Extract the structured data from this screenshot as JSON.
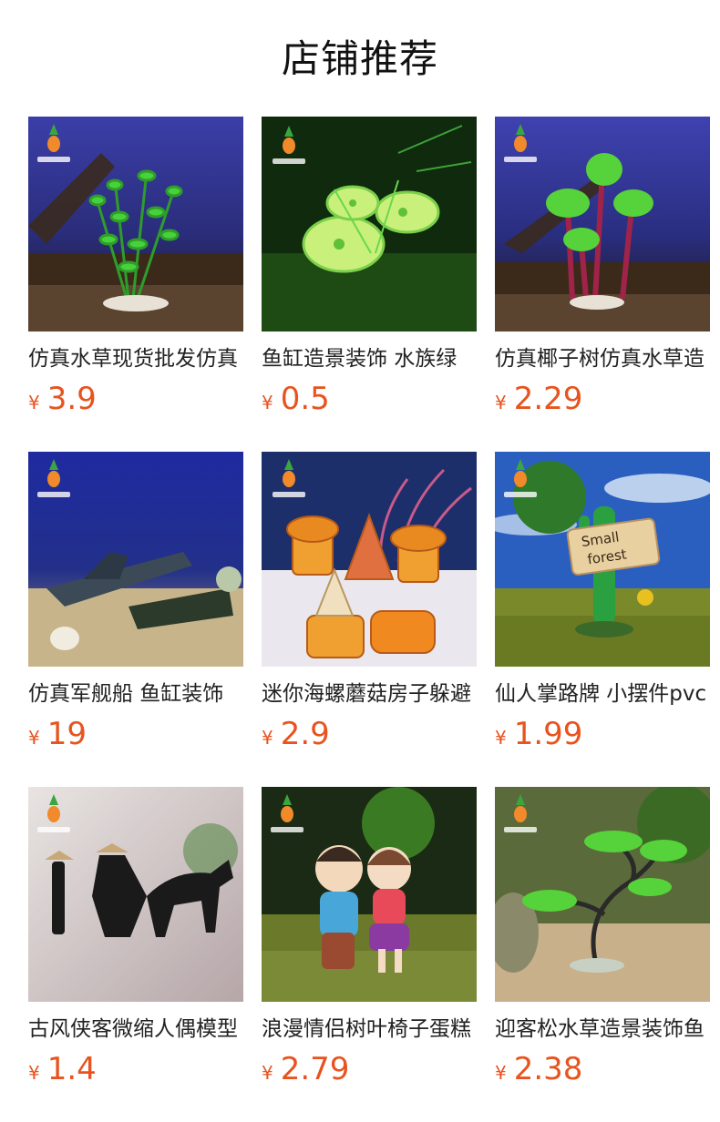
{
  "section_title": "店铺推荐",
  "currency": "¥",
  "accent_color": "#e8531f",
  "products": [
    {
      "name": "仿真水草现货批发仿真",
      "price": "3.9",
      "image": "aquarium-plant-green"
    },
    {
      "name": "鱼缸造景装饰 水族绿",
      "price": "0.5",
      "image": "lotus-leaf-plant"
    },
    {
      "name": "仿真椰子树仿真水草造",
      "price": "2.29",
      "image": "coconut-tree-plant"
    },
    {
      "name": "仿真军舰船 鱼缸装饰",
      "price": "19",
      "image": "warship-wreck"
    },
    {
      "name": "迷你海螺蘑菇房子躲避",
      "price": "2.9",
      "image": "mushroom-houses"
    },
    {
      "name": "仙人掌路牌 小摆件pvc",
      "price": "1.99",
      "image": "cactus-signpost"
    },
    {
      "name": "古风侠客微缩人偶模型",
      "price": "1.4",
      "image": "swordsman-figures"
    },
    {
      "name": "浪漫情侣树叶椅子蛋糕",
      "price": "2.79",
      "image": "couple-figurine"
    },
    {
      "name": "迎客松水草造景装饰鱼",
      "price": "2.38",
      "image": "pine-tree-bonsai"
    }
  ],
  "sign_text": [
    "Small",
    "forest"
  ]
}
